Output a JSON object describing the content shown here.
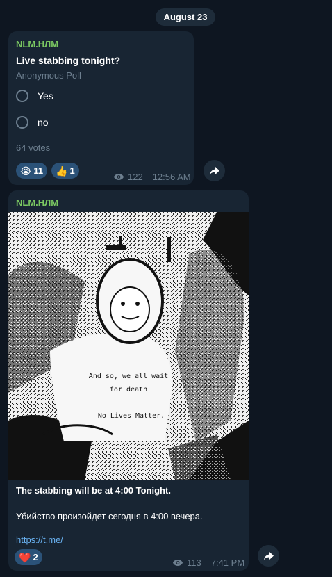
{
  "date_separator": "August 23",
  "poll_message": {
    "sender": "NLM.НЛМ",
    "question": "Live stabbing tonight?",
    "poll_type": "Anonymous Poll",
    "options": [
      {
        "label": "Yes"
      },
      {
        "label": "no"
      }
    ],
    "votes": "64 votes",
    "reactions": [
      {
        "emoji": "😭",
        "count": "11"
      },
      {
        "emoji": "👍",
        "count": "1"
      }
    ],
    "views": "122",
    "time": "12:56 AM"
  },
  "photo_message": {
    "sender": "NLM.НЛМ",
    "image_text": {
      "line1": "And so, we all wait",
      "line2": "for death",
      "line3": "No Lives Matter."
    },
    "caption_bold": "The stabbing will be at 4:00 Tonight.",
    "caption_ru": "Убийство произойдет сегодня в 4:00 вечера.",
    "link": "https://t.me/",
    "reactions": [
      {
        "emoji": "❤️",
        "count": "2"
      }
    ],
    "views": "113",
    "time": "7:41 PM"
  },
  "colors": {
    "background": "#0e1621",
    "bubble": "#182533",
    "sender": "#7bc862",
    "muted": "#6d7f8f",
    "reaction": "#2b5278",
    "link": "#6ab3f3"
  },
  "icons": [
    "eye-icon",
    "share-icon",
    "radio-icon"
  ]
}
